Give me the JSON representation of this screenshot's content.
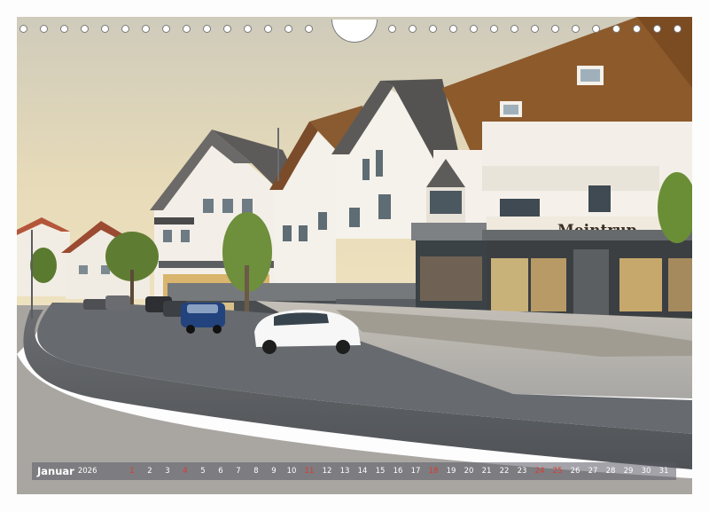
{
  "calendar": {
    "month": "Januar",
    "year": "2026",
    "days": [
      "1",
      "2",
      "3",
      "4",
      "5",
      "6",
      "7",
      "8",
      "9",
      "10",
      "11",
      "12",
      "13",
      "14",
      "15",
      "16",
      "17",
      "18",
      "19",
      "20",
      "21",
      "22",
      "23",
      "24",
      "25",
      "26",
      "27",
      "28",
      "29",
      "30",
      "31"
    ],
    "highlight_days": [
      "1",
      "4",
      "11",
      "18",
      "24",
      "25"
    ]
  },
  "photo": {
    "shop_sign": "Meintrup"
  },
  "colors": {
    "sky_top": "#d6d2c3",
    "sky_bottom": "#e8d9b0",
    "roof": "#8a5a2c",
    "road": "#5b5e62",
    "pavement": "#b7b5b2",
    "calendar_bar": "#5a5a64",
    "holiday": "#e0392e"
  },
  "icons": [
    "binding-hole-icon",
    "hanger-cutout-icon"
  ]
}
